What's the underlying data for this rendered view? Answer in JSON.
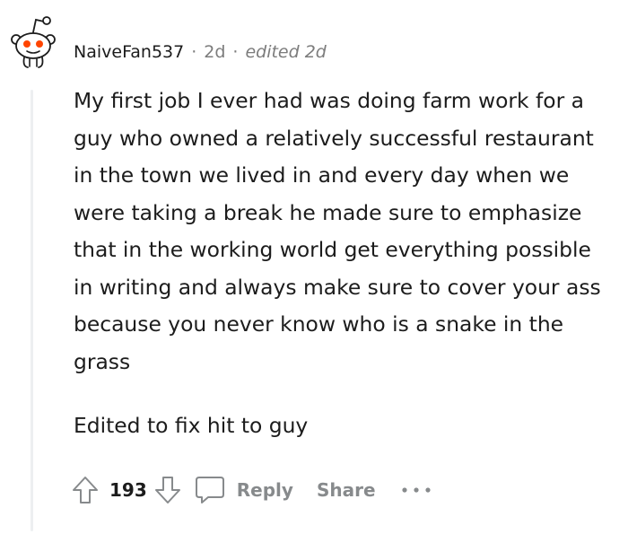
{
  "comment": {
    "author": "NaiveFan537",
    "age": "2d",
    "edited": "edited 2d",
    "body": [
      "My first job I ever had was doing farm work for a guy who owned a relatively successful restaurant in the town we lived in and every day when we were taking a break he made sure to emphasize that in the working world get everything possible in writing and always make sure to cover your ass because you never know who is a snake in the grass",
      "Edited to fix hit to guy"
    ],
    "score": "193",
    "actions": {
      "reply": "Reply",
      "share": "Share"
    }
  },
  "icons": {
    "avatar": "snoo-avatar-icon",
    "upvote": "upvote-arrow-icon",
    "downvote": "downvote-arrow-icon",
    "reply": "speech-bubble-icon",
    "more": "ellipsis-icon"
  },
  "colors": {
    "text": "#1c1c1c",
    "meta": "#7c7c7c",
    "action": "#878a8c",
    "thread_line": "#edeff1",
    "snoo_red": "#ff4500"
  }
}
